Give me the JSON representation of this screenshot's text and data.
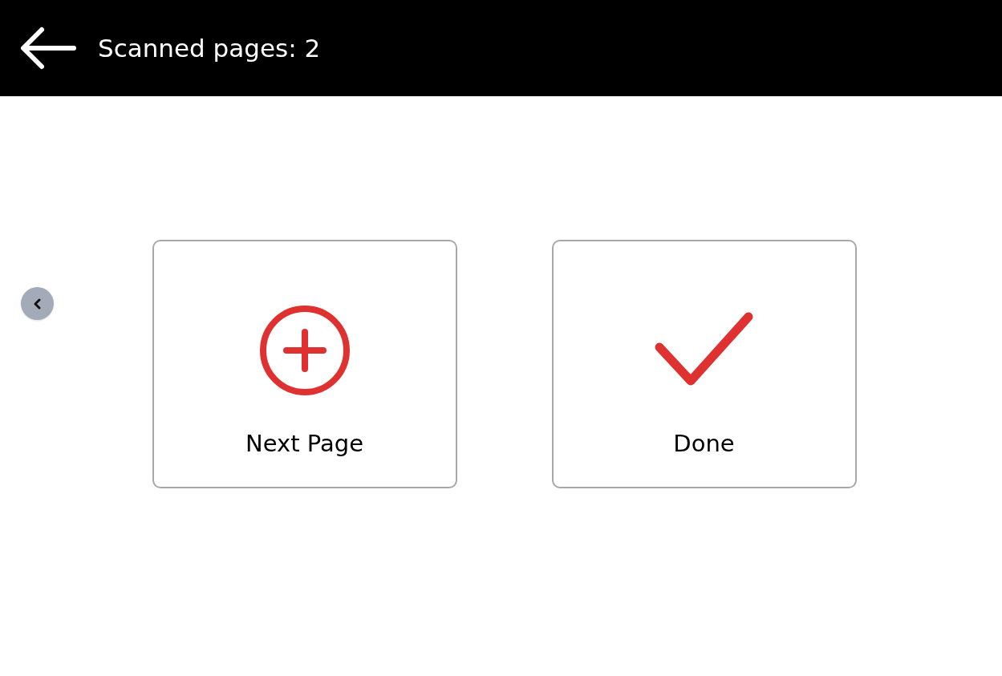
{
  "header": {
    "title": "Scanned pages: 2"
  },
  "actions": [
    {
      "kind": "add",
      "label": "Next Page"
    },
    {
      "kind": "done",
      "label": "Done"
    }
  ]
}
